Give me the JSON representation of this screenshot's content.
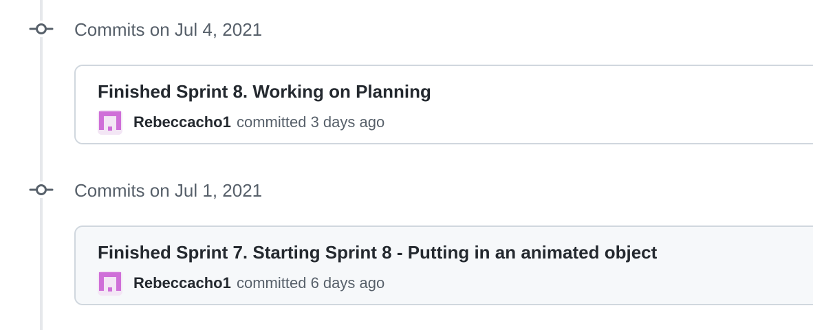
{
  "colors": {
    "timeline": "#e6e8eb",
    "icon": "#57606a",
    "border": "#d0d7de",
    "avatar": "#cf6fd8",
    "muted_text": "#57606a",
    "text": "#24292f"
  },
  "groups": [
    {
      "title": "Commits on Jul 4, 2021",
      "icon": "git-commit-icon",
      "commits": [
        {
          "message": "Finished Sprint 8. Working on Planning",
          "author": "Rebeccacho1",
          "action": "committed 3 days ago",
          "avatar_icon": "identicon-avatar"
        }
      ]
    },
    {
      "title": "Commits on Jul 1, 2021",
      "icon": "git-commit-icon",
      "commits": [
        {
          "message": "Finished Sprint 7. Starting Sprint 8 - Putting in an animated object",
          "author": "Rebeccacho1",
          "action": "committed 6 days ago",
          "avatar_icon": "identicon-avatar"
        }
      ]
    }
  ]
}
